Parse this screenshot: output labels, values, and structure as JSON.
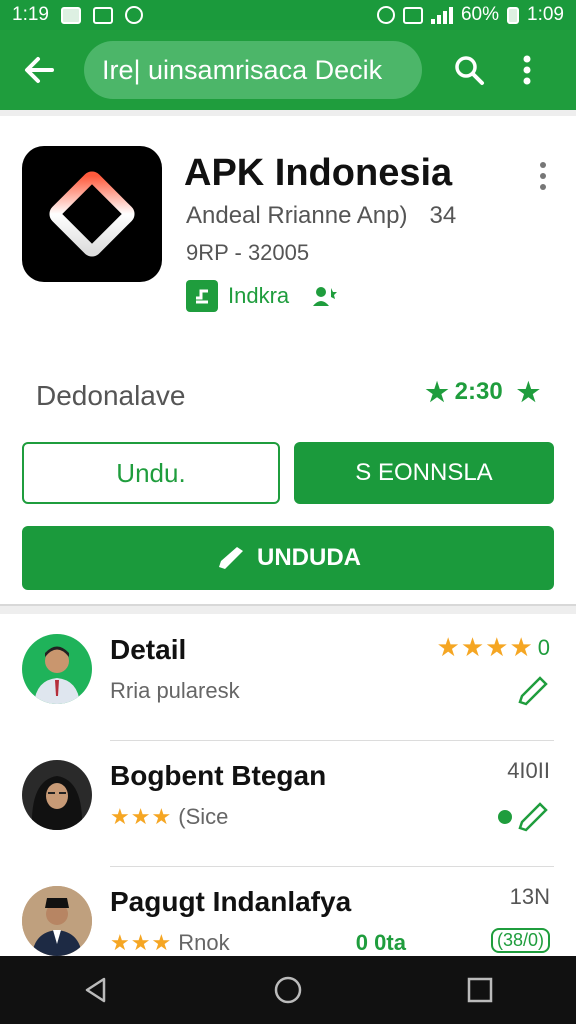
{
  "status_bar": {
    "time": "1:19",
    "battery": "60%",
    "clock_right": "1:09"
  },
  "app_bar": {
    "search_text": "Ire| uinsamrisaca Decik",
    "icons": [
      "back-arrow-icon",
      "search-icon",
      "more-vert-icon"
    ]
  },
  "app": {
    "title": "APK Indonesia",
    "subtitle": "Andeal Rrianne Anp)",
    "subtitle_num": "34",
    "size_line": "9RP - 32005",
    "developer": "Indkra",
    "rating_label": "Dedonalave",
    "rating_value": "2:30",
    "button_outline": "Undu.",
    "button_solid": "S EONNSLA",
    "button_wide": "UNDUDA"
  },
  "list": [
    {
      "title": "Detail",
      "sub": "Rria pularesk",
      "stars": "",
      "right_top": "0",
      "right_bottom": ""
    },
    {
      "title": "Bogbent  Btegan",
      "sub": "(Sice",
      "stars": "★★★",
      "right_top": "4I0II",
      "right_bottom": ""
    },
    {
      "title": "Pagugt  Indanlafya",
      "sub": "Rnok",
      "stars": "★★★",
      "right_top": "13N",
      "right_bottom": "(38/0)",
      "mid_tag": "0 0ta"
    }
  ],
  "colors": {
    "primary_green": "#1b9a3c",
    "star_gold": "#f5a623"
  }
}
